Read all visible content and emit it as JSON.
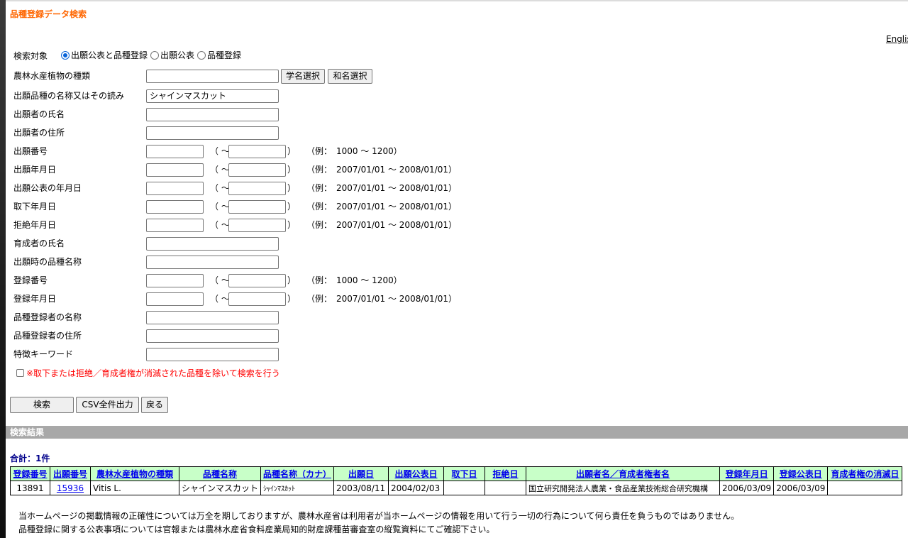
{
  "page_title": "品種登録データ検索",
  "english_link": "English",
  "search_target": {
    "label": "検索対象",
    "options": [
      "出願公表と品種登録",
      "出願公表",
      "品種登録"
    ],
    "selected": "出願公表と品種登録"
  },
  "fields": {
    "crop_type": {
      "label": "農林水産植物の種類",
      "value": ""
    },
    "scientific_name_button": "学名選択",
    "japanese_name_button": "和名選択",
    "variety_name": {
      "label": "出願品種の名称又はその読み",
      "value": "シャインマスカット"
    },
    "applicant_name": {
      "label": "出願者の氏名",
      "value": ""
    },
    "applicant_address": {
      "label": "出願者の住所",
      "value": ""
    },
    "application_number": {
      "label": "出願番号",
      "example": "（例：　1000 〜 1200）"
    },
    "application_date": {
      "label": "出願年月日",
      "example": "（例：　2007/01/01 〜 2008/01/01）"
    },
    "publication_date": {
      "label": "出願公表の年月日",
      "example": "（例：　2007/01/01 〜 2008/01/01）"
    },
    "withdrawal_date": {
      "label": "取下年月日",
      "example": "（例：　2007/01/01 〜 2008/01/01）"
    },
    "rejection_date": {
      "label": "拒絶年月日",
      "example": "（例：　2007/01/01 〜 2008/01/01）"
    },
    "breeder_name": {
      "label": "育成者の氏名",
      "value": ""
    },
    "name_at_application": {
      "label": "出願時の品種名称",
      "value": ""
    },
    "registration_number": {
      "label": "登録番号",
      "example": "（例：　1000 〜 1200）"
    },
    "registration_date": {
      "label": "登録年月日",
      "example": "（例：　2007/01/01 〜 2008/01/01）"
    },
    "registrant_name": {
      "label": "品種登録者の名称",
      "value": ""
    },
    "registrant_address": {
      "label": "品種登録者の住所",
      "value": ""
    },
    "keyword": {
      "label": "特徴キーワード",
      "value": ""
    }
  },
  "range_tilde": "（ 〜",
  "range_close": "）",
  "exclude_checkbox": {
    "label": "※取下または拒絶／育成者権が消滅された品種を除いて検索を行う",
    "checked": false
  },
  "buttons": {
    "search": "検索",
    "csv": "CSV全件出力",
    "back": "戻る"
  },
  "results": {
    "bar_label": "検索結果",
    "total": "合計：1件",
    "columns": [
      "登録番号",
      "出願番号",
      "農林水産植物の種類",
      "品種名称",
      "品種名称（カナ）",
      "出願日",
      "出願公表日",
      "取下日",
      "拒絶日",
      "出願者名／育成者権者名",
      "登録年月日",
      "登録公表日",
      "育成者権の消滅日"
    ],
    "rows": [
      [
        "13891",
        "15936",
        "Vitis L.",
        "シャインマスカット",
        "ｼｬｲﾝﾏｽｶｯﾄ",
        "2003/08/11",
        "2004/02/03",
        "",
        "",
        "国立研究開発法人農業・食品産業技術総合研究機構",
        "2006/03/09",
        "2006/03/09",
        ""
      ]
    ]
  },
  "footer": {
    "line1": "当ホームページの掲載情報の正確性については万全を期しておりますが、農林水産省は利用者が当ホームページの情報を用いて行う一切の行為について何ら責任を負うものではありません。",
    "line2": "品種登録に関する公表事項については官報または農林水産省食料産業局知的財産課種苗審査室の縦覧資料にてご確認下さい。"
  },
  "colors": {
    "title": "#ff6600",
    "header_bg": "#c8ffc8",
    "result_bar": "#a8a8a8",
    "warning": "#ff0000",
    "total": "#00008b"
  }
}
